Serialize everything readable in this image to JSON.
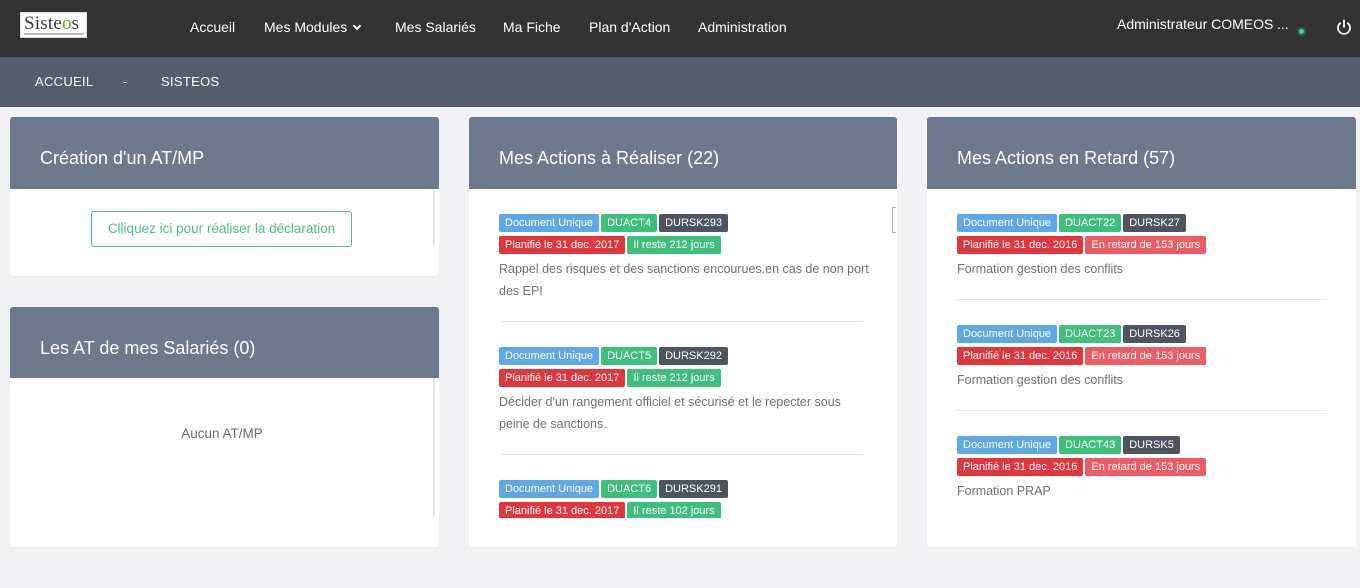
{
  "app": {
    "logo_text": "Sisteos",
    "accent_color": "#4bbf7f",
    "header_color": "#6d7a8c"
  },
  "nav": {
    "items": [
      "Accueil",
      "Mes Modules",
      "Mes Salariés",
      "Ma Fiche",
      "Plan d'Action",
      "Administration"
    ],
    "user": "Administrateur COMEOS",
    "user_more": "..."
  },
  "breadcrumb": {
    "home": "ACCUEIL",
    "separator": "-",
    "current": "SISTEOS"
  },
  "panels": {
    "creation": {
      "title": "Création d'un AT/MP",
      "button": "Clliquez ici pour réaliser la déclaration"
    },
    "at_salaries": {
      "title": "Les AT de mes Salariés (0)",
      "empty": "Aucun AT/MP"
    },
    "a_realiser": {
      "title": "Mes Actions à Réaliser (22)",
      "actions": [
        {
          "type": "Document Unique",
          "action": "DUACT4",
          "risk": "DURSK293",
          "planned": "Planifié le 31 dec. 2017",
          "remaining": "Il reste 212 jours",
          "description": "Rappel des risques et des sanctions encourues.en cas de non port des EPI"
        },
        {
          "type": "Document Unique",
          "action": "DUACT5",
          "risk": "DURSK292",
          "planned": "Planifié le 31 dec. 2017",
          "remaining": "Il reste 212 jours",
          "description": "Décider d'un rangement officiel et sécurisé et le repecter sous peine de sanctions."
        },
        {
          "type": "Document Unique",
          "action": "DUACT6",
          "risk": "DURSK291",
          "planned": "Planifié le 31 dec. 2017",
          "remaining": "Il reste 102 jours",
          "description": ""
        }
      ]
    },
    "en_retard": {
      "title": "Mes Actions en Retard (57)",
      "actions": [
        {
          "type": "Document Unique",
          "action": "DUACT22",
          "risk": "DURSK27",
          "planned": "Planifié le 31 dec. 2016",
          "late": "En retard de 153 jours",
          "description": "Formation gestion des conflits"
        },
        {
          "type": "Document Unique",
          "action": "DUACT23",
          "risk": "DURSK26",
          "planned": "Planifié le 31 dec. 2016",
          "late": "En retard de 153 jours",
          "description": "Formation gestion des conflits"
        },
        {
          "type": "Document Unique",
          "action": "DUACT43",
          "risk": "DURSK5",
          "planned": "Planifié le 31 dec. 2016",
          "late": "En retard de 153 jours",
          "description": "Formation PRAP"
        }
      ]
    }
  }
}
